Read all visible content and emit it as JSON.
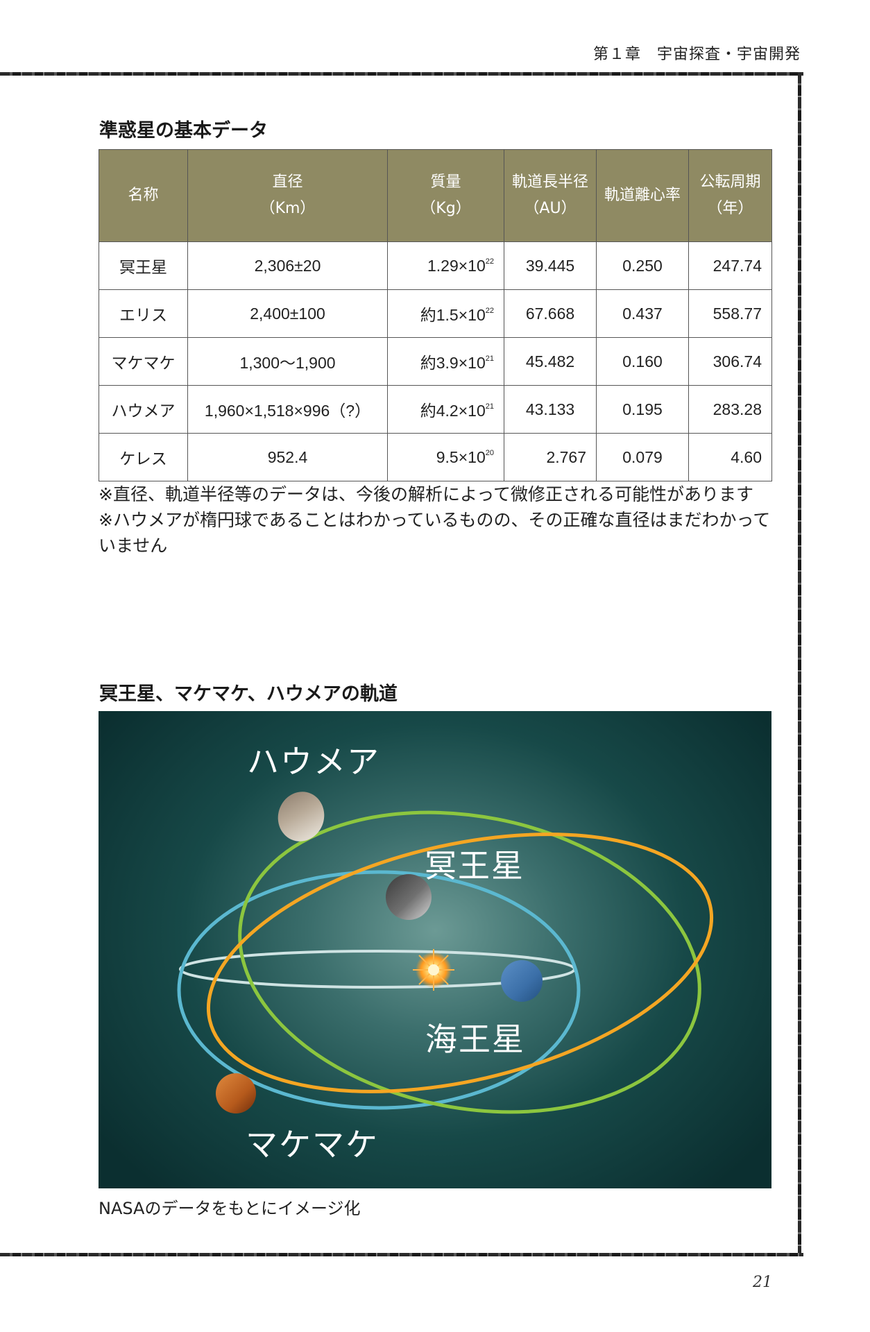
{
  "header": {
    "chapter": "第１章　宇宙探査・宇宙開発"
  },
  "table_section": {
    "title": "準惑星の基本データ",
    "headers": [
      [
        "名称"
      ],
      [
        "直径",
        "（Km）"
      ],
      [
        "質量",
        "（Kg）"
      ],
      [
        "軌道長半径",
        "（AU）"
      ],
      [
        "軌道離心率"
      ],
      [
        "公転周期",
        "（年）"
      ]
    ],
    "rows": [
      {
        "name": "冥王星",
        "diameter": "2,306±20",
        "mass_prefix": "",
        "mass_base": "1.29×10",
        "mass_exp": "22",
        "axis": "39.445",
        "ecc": "0.250",
        "period": "247.74"
      },
      {
        "name": "エリス",
        "diameter": "2,400±100",
        "mass_prefix": "約",
        "mass_base": "1.5×10",
        "mass_exp": "22",
        "axis": "67.668",
        "ecc": "0.437",
        "period": "558.77"
      },
      {
        "name": "マケマケ",
        "diameter": "1,300～1,900",
        "mass_prefix": "約",
        "mass_base": "3.9×10",
        "mass_exp": "21",
        "axis": "45.482",
        "ecc": "0.160",
        "period": "306.74"
      },
      {
        "name": "ハウメア",
        "diameter": "1,960×1,518×996（?）",
        "mass_prefix": "約",
        "mass_base": "4.2×10",
        "mass_exp": "21",
        "axis": "43.133",
        "ecc": "0.195",
        "period": "283.28"
      },
      {
        "name": "ケレス",
        "diameter": "952.4",
        "mass_prefix": "",
        "mass_base": "9.5×10",
        "mass_exp": "20",
        "axis": "2.767",
        "ecc": "0.079",
        "period": "4.60"
      }
    ],
    "notes": [
      "※直径、軌道半径等のデータは、今後の解析によって微修正される可能性があります",
      "※ハウメアが楕円球であることはわかっているものの、その正確な直径はまだわかっていません"
    ]
  },
  "orbit_section": {
    "title": "冥王星、マケマケ、ハウメアの軌道",
    "labels": {
      "haumea": "ハウメア",
      "pluto": "冥王星",
      "neptune": "海王星",
      "makemake": "マケマケ"
    },
    "colors": {
      "haumea_orbit": "#8cc63f",
      "makemake_orbit": "#f5a623",
      "pluto_orbit": "#5bb8d0",
      "neptune_orbit": "#cfe3e3",
      "sun": "#ff9a1f"
    },
    "caption": "NASAのデータをもとにイメージ化"
  },
  "page_number": "21"
}
